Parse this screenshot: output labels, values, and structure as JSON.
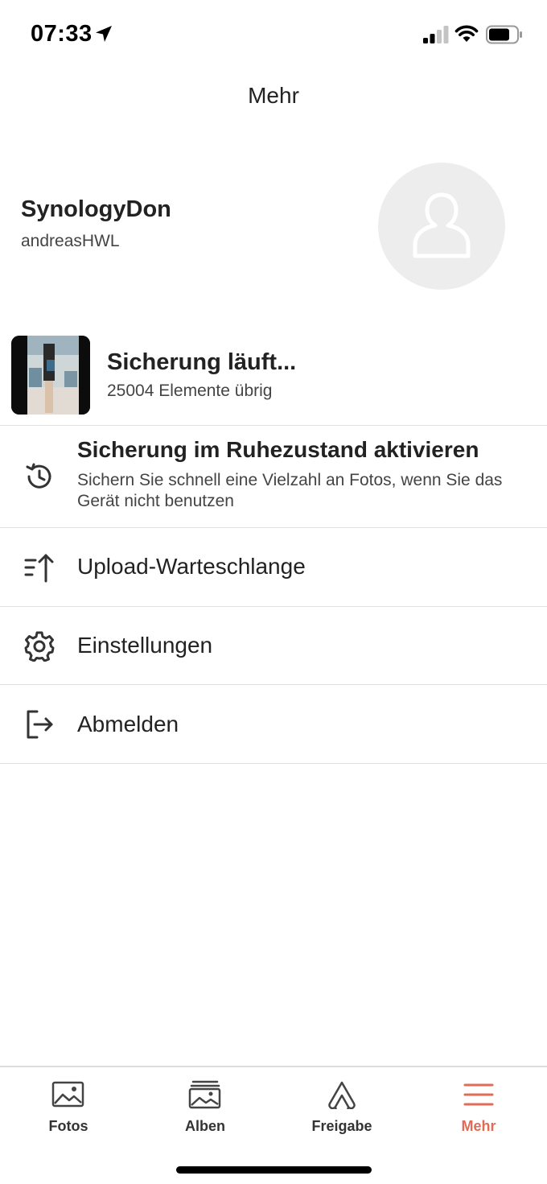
{
  "status_bar": {
    "time": "07:33",
    "icons": [
      "location-arrow-icon",
      "cellular-signal-icon",
      "wifi-icon",
      "battery-icon"
    ]
  },
  "header": {
    "title": "Mehr"
  },
  "profile": {
    "server_name": "SynologyDon",
    "account_name": "andreasHWL",
    "avatar_icon": "user-placeholder-icon"
  },
  "backup": {
    "title": "Sicherung läuft...",
    "subtitle": "25004 Elemente übrig"
  },
  "menu": {
    "sleep_backup": {
      "title": "Sicherung im Ruhezustand aktivieren",
      "description": "Sichern Sie schnell eine Vielzahl an Fotos, wenn Sie das Gerät nicht benutzen",
      "icon": "history-icon"
    },
    "upload_queue": {
      "label": "Upload-Warteschlange",
      "icon": "upload-queue-icon"
    },
    "settings": {
      "label": "Einstellungen",
      "icon": "gear-icon"
    },
    "logout": {
      "label": "Abmelden",
      "icon": "logout-icon"
    }
  },
  "tab_bar": {
    "tabs": [
      {
        "label": "Fotos",
        "icon": "photo-icon",
        "active": false
      },
      {
        "label": "Alben",
        "icon": "albums-icon",
        "active": false
      },
      {
        "label": "Freigabe",
        "icon": "share-icon",
        "active": false
      },
      {
        "label": "Mehr",
        "icon": "menu-icon",
        "active": true
      }
    ]
  },
  "colors": {
    "accent": "#e06b57",
    "divider": "#e0e0e0",
    "avatar_bg": "#ededed"
  }
}
